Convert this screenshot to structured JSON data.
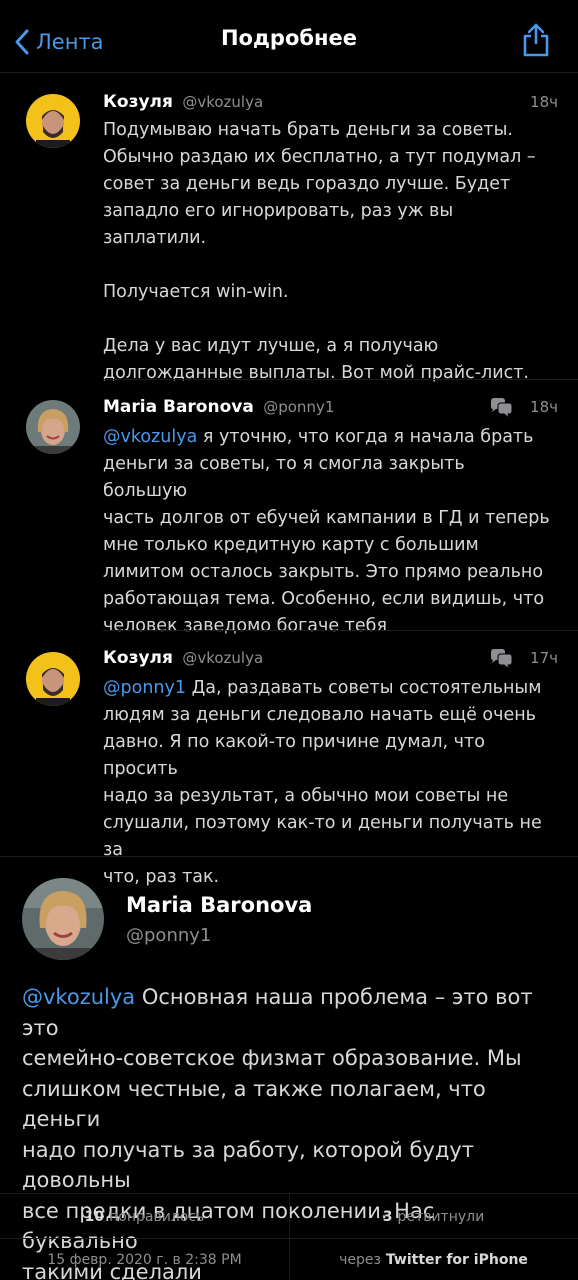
{
  "nav": {
    "back_label": "Лента",
    "title": "Подробнее",
    "share_icon": "share-icon",
    "accent": "#4a98ea"
  },
  "thread": [
    {
      "name": "Козуля",
      "handle": "@vkozulya",
      "time": "18ч",
      "mention": "",
      "text": "Подумываю начать брать деньги за советы.\nОбычно раздаю их бесплатно, а тут подумал –\nсовет за деньги ведь гораздо лучше. Будет\nзападло его игнорировать, раз уж вы заплатили.\n\nПолучается win-win.\n\nДела у вас идут лучше, а я получаю\nдолгожданные выплаты. Вот мой прайс-лист."
    },
    {
      "name": "Maria Baronova",
      "handle": "@ponny1",
      "time": "18ч",
      "mention": "@vkozulya",
      "text": " я уточню, что когда я начала брать\nденьги за советы, то я смогла закрыть большую\nчасть долгов от ебучей кампании в ГД и теперь\nмне только кредитную карту с большим\nлимитом осталось закрыть. Это прямо реально\nработающая тема. Особенно, если видишь, что\nчеловек заведомо богаче тебя"
    },
    {
      "name": "Козуля",
      "handle": "@vkozulya",
      "time": "17ч",
      "mention": "@ponny1",
      "text": " Да, раздавать советы состоятельным\nлюдям за деньги следовало начать ещё очень\nдавно. Я по какой-то причине думал, что просить\nнадо за результат, а обычно мои советы не\nслушали, поэтому как-то и деньги получать не за\nчто, раз так."
    }
  ],
  "main": {
    "name": "Maria Baronova",
    "handle": "@ponny1",
    "mention": "@vkozulya",
    "text": " Основная наша проблема – это вот это\nсемейно-советское физмат образование. Мы\nслишком честные, а также полагаем, что деньги\nнадо получать за работу, которой будут довольны\nвсе предки в дцатом поколении. Нас буквально\nтакими сделали"
  },
  "stats": {
    "likes_count": "10",
    "likes_label": "понравилось",
    "retweets_count": "3",
    "retweets_label": "ретвитнули",
    "date": "15 февр. 2020 г. в 2:38 PM",
    "via_label": "через",
    "via_app": "Twitter for iPhone"
  }
}
